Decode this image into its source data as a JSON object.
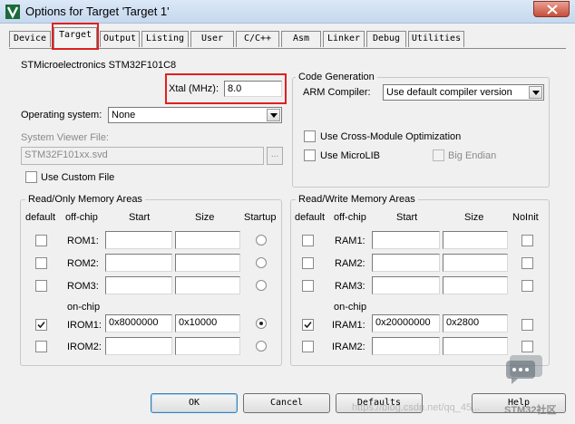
{
  "window": {
    "title": "Options for Target 'Target 1'",
    "close_glyph": "✕",
    "icon": "keil-app-icon"
  },
  "tabs": [
    {
      "label": "Device"
    },
    {
      "label": "Target"
    },
    {
      "label": "Output"
    },
    {
      "label": "Listing"
    },
    {
      "label": "User"
    },
    {
      "label": "C/C++"
    },
    {
      "label": "Asm"
    },
    {
      "label": "Linker"
    },
    {
      "label": "Debug"
    },
    {
      "label": "Utilities"
    }
  ],
  "active_tab": "Target",
  "device": {
    "name": "STMicroelectronics STM32F101C8",
    "xtal_label": "Xtal (MHz):",
    "xtal_value": "8.0"
  },
  "operating_system": {
    "label": "Operating system:",
    "value": "None"
  },
  "system_viewer": {
    "label": "System Viewer File:",
    "value": "STM32F101xx.svd",
    "browse_label": "...",
    "use_custom_label": "Use Custom File",
    "use_custom_checked": false
  },
  "code_generation": {
    "title": "Code Generation",
    "arm_compiler_label": "ARM Compiler:",
    "arm_compiler_value": "Use default compiler version",
    "cross_module_label": "Use Cross-Module Optimization",
    "cross_module_checked": false,
    "microlib_label": "Use MicroLIB",
    "microlib_checked": false,
    "big_endian_label": "Big Endian",
    "big_endian_checked": false
  },
  "ro_memory": {
    "title": "Read/Only Memory Areas",
    "headers": {
      "default": "default",
      "offchip": "off-chip",
      "start": "Start",
      "size": "Size",
      "startup": "Startup"
    },
    "onchip_label": "on-chip",
    "rows": [
      {
        "name": "ROM1:",
        "checked": false,
        "start": "",
        "size": "",
        "startup": false
      },
      {
        "name": "ROM2:",
        "checked": false,
        "start": "",
        "size": "",
        "startup": false
      },
      {
        "name": "ROM3:",
        "checked": false,
        "start": "",
        "size": "",
        "startup": false
      },
      {
        "name": "IROM1:",
        "checked": true,
        "start": "0x8000000",
        "size": "0x10000",
        "startup": true
      },
      {
        "name": "IROM2:",
        "checked": false,
        "start": "",
        "size": "",
        "startup": false
      }
    ]
  },
  "rw_memory": {
    "title": "Read/Write Memory Areas",
    "headers": {
      "default": "default",
      "offchip": "off-chip",
      "start": "Start",
      "size": "Size",
      "noinit": "NoInit"
    },
    "onchip_label": "on-chip",
    "rows": [
      {
        "name": "RAM1:",
        "checked": false,
        "start": "",
        "size": "",
        "noinit": false
      },
      {
        "name": "RAM2:",
        "checked": false,
        "start": "",
        "size": "",
        "noinit": false
      },
      {
        "name": "RAM3:",
        "checked": false,
        "start": "",
        "size": "",
        "noinit": false
      },
      {
        "name": "IRAM1:",
        "checked": true,
        "start": "0x20000000",
        "size": "0x2800",
        "noinit": false
      },
      {
        "name": "IRAM2:",
        "checked": false,
        "start": "",
        "size": "",
        "noinit": false
      }
    ]
  },
  "buttons": {
    "ok": "OK",
    "cancel": "Cancel",
    "defaults": "Defaults",
    "help": "Help"
  },
  "watermark": {
    "url_text": "https://blog.csdn.net/qq_45...",
    "brand_text": "STM32社区"
  },
  "colors": {
    "highlight": "#e02020",
    "titlebar": "#c5d8ee"
  }
}
